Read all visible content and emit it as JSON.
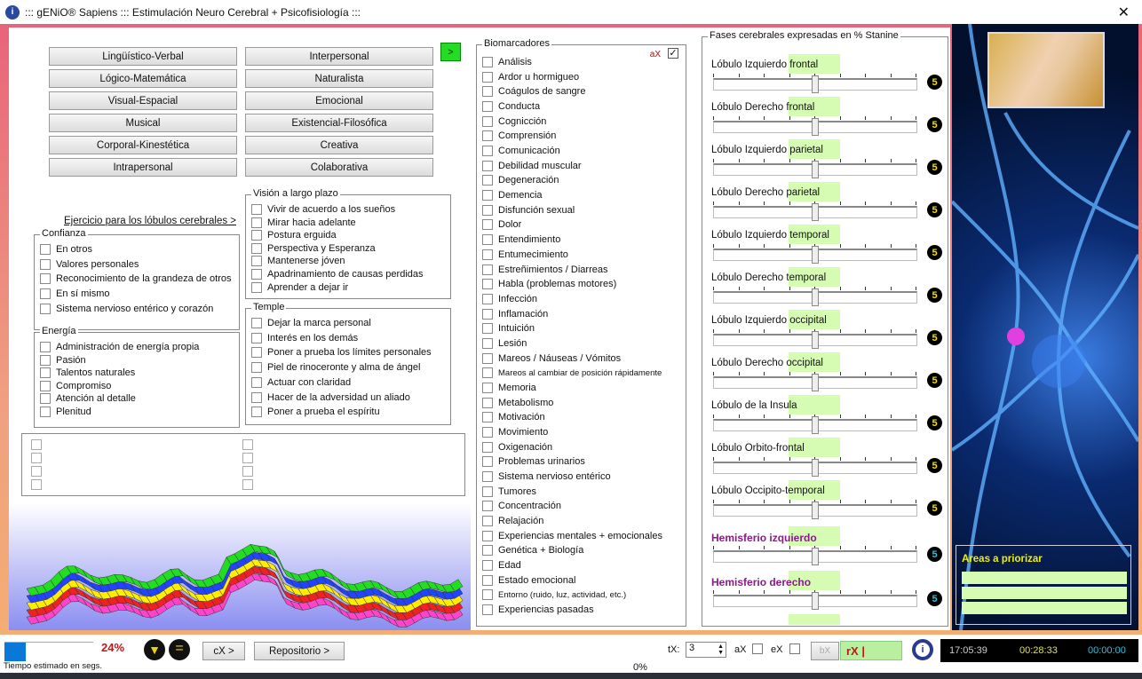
{
  "window": {
    "title": "::: gENiO® Sapiens ::: Estimulación Neuro Cerebral + Psicofisiología :::",
    "close": "✕"
  },
  "intelligences": {
    "left": [
      "Lingüístico-Verbal",
      "Lógico-Matemática",
      "Visual-Espacial",
      "Musical",
      "Corporal-Kinestética",
      "Intrapersonal"
    ],
    "right": [
      "Interpersonal",
      "Naturalista",
      "Emocional",
      "Existencial-Filosófica",
      "Creativa",
      "Colaborativa"
    ],
    "go_button": ">"
  },
  "exercise_link": "Ejercicio para los lóbulos cerebrales >",
  "confianza": {
    "title": "Confianza",
    "items": [
      "En otros",
      "Valores personales",
      "Reconocimiento de la grandeza de otros",
      "En sí mismo",
      "Sistema nervioso entérico y corazón"
    ]
  },
  "energia": {
    "title": "Energía",
    "items": [
      "Administración de energía propia",
      "Pasión",
      "Talentos naturales",
      "Compromiso",
      "Atención al detalle",
      "Plenitud"
    ]
  },
  "vision": {
    "title": "Visión a largo plazo",
    "items": [
      "Vivir de acuerdo a los sueños",
      "Mirar hacia adelante",
      "Postura erguida",
      "Perspectiva y Esperanza",
      "Mantenerse jóven",
      "Apadrinamiento de causas perdidas",
      "Aprender a dejar ir"
    ]
  },
  "temple": {
    "title": "Temple",
    "items": [
      "Dejar la marca personal",
      "Interés en los demás",
      "Poner a prueba los límites personales",
      "Piel de rinoceronte y alma de ángel",
      "Actuar con claridad",
      "Hacer de la adversidad un aliado",
      "Poner a prueba el espíritu"
    ]
  },
  "biomarcadores": {
    "title": "Biomarcadores",
    "ax_label": "aX",
    "ax_checked": true,
    "items": [
      "Análisis",
      "Ardor u hormigueo",
      "Coágulos de sangre",
      "Conducta",
      "Cognicción",
      "Comprensión",
      "Comunicación",
      "Debilidad muscular",
      "Degeneración",
      "Demencia",
      "Disfunción sexual",
      "Dolor",
      "Entendimiento",
      "Entumecimiento",
      "Estreñimientos / Diarreas",
      "Habla (problemas motores)",
      "Infección",
      "Inflamación",
      "Intuición",
      "Lesión",
      "Mareos / Náuseas / Vómitos",
      "Mareos al cambiar de posición rápidamente",
      "Memoria",
      "Metabolismo",
      "Motivación",
      "Movimiento",
      "Oxigenación",
      "Problemas urinarios",
      "Sistema nervioso entérico",
      "Tumores",
      "Concentración",
      "Relajación",
      "Experiencias mentales + emocionales",
      "Genética + Biología",
      "Edad",
      "Estado emocional",
      "Entorno (ruido, luz, actividad, etc.)",
      "Experiencias pasadas"
    ]
  },
  "fases": {
    "title": "Fases cerebrales expresadas en % Stanine",
    "scale_max": 9,
    "sliders": [
      {
        "label": "Lóbulo Izquierdo frontal",
        "value": "5"
      },
      {
        "label": "Lóbulo Derecho frontal",
        "value": "5"
      },
      {
        "label": "Lóbulo Izquierdo parietal",
        "value": "5"
      },
      {
        "label": "Lóbulo Derecho parietal",
        "value": "5"
      },
      {
        "label": "Lóbulo Izquierdo temporal",
        "value": "5"
      },
      {
        "label": "Lóbulo Derecho temporal",
        "value": "5"
      },
      {
        "label": "Lóbulo Izquierdo occipital",
        "value": "5"
      },
      {
        "label": "Lóbulo Derecho occipital",
        "value": "5"
      },
      {
        "label": "Lóbulo de la Insula",
        "value": "5"
      },
      {
        "label": "Lóbulo Orbito-frontal",
        "value": "5"
      },
      {
        "label": "Lóbulo Occipito-temporal",
        "value": "5"
      }
    ],
    "hemispheres": [
      {
        "label": "Hemisferio izquierdo",
        "value": "5"
      },
      {
        "label": "Hemisferio derecho",
        "value": "5"
      }
    ],
    "hemisphere_color": "#8a1a8a"
  },
  "areas": {
    "title": "Areas a priorizar",
    "color": "#f0f000"
  },
  "bottom": {
    "progress_pct": "24%",
    "status": "Tiempo estimado en segs.",
    "cx": "cX >",
    "repositorio": "Repositorio >",
    "center_pct": "0%",
    "tx_label": "tX:",
    "tx_value": "3",
    "ax": "aX",
    "ex": "eX",
    "bx": "bX",
    "rx": "rX |",
    "clock": "17:05:39",
    "elapsed": "00:28:33",
    "remaining": "00:00:00"
  }
}
